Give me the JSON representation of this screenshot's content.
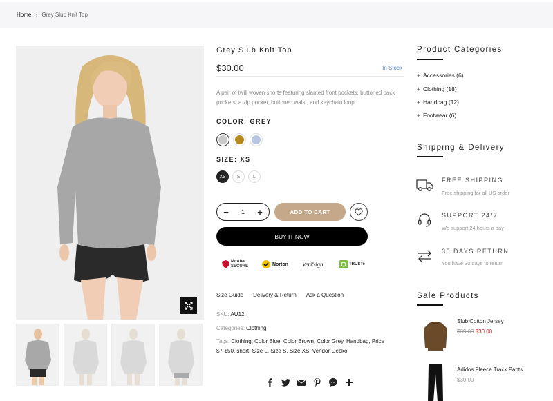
{
  "breadcrumb": {
    "home": "Home",
    "current": "Grey Slub Knit Top"
  },
  "product": {
    "title": "Grey Slub Knit Top",
    "price": "$30.00",
    "stock": "In Stock",
    "description": "A pair of twill woven shorts featuring slanted front pockets, buttoned back pockets, a zip pocket, buttoned waist, and keychain loop.",
    "color_label": "COLOR: GREY",
    "colors": [
      "#c9c9c9",
      "#b58a1e",
      "#b6c6de"
    ],
    "size_label": "SIZE: XS",
    "sizes": [
      "XS",
      "S",
      "L"
    ],
    "quantity": "1",
    "add_to_cart": "ADD TO CART",
    "buy_now": "BUY IT NOW",
    "trust_badges": [
      "McAfee SECURE",
      "Norton",
      "VeriSign",
      "TRUSTe"
    ],
    "links": [
      "Size Guide",
      "Delivery & Return",
      "Ask a Question"
    ],
    "sku_label": "SKU:",
    "sku": "AU12",
    "categories_label": "Categories:",
    "categories": "Clothing",
    "tags_label": "Tags:",
    "tags": "Clothing, Color Blue, Color Brown, Color Grey, Handbag, Price $7-$50, short, Size L, Size S, Size XS, Vendor Gecko"
  },
  "sidebar": {
    "categories_title": "Product Categories",
    "categories": [
      {
        "label": "Accessories (6)"
      },
      {
        "label": "Clothing (18)"
      },
      {
        "label": "Handbag (12)"
      },
      {
        "label": "Footwear (6)"
      }
    ],
    "shipping_title": "Shipping & Delivery",
    "shipping": [
      {
        "icon": "truck-icon",
        "title": "FREE SHIPPING",
        "subtitle": "Free shipping for all US order"
      },
      {
        "icon": "headset-icon",
        "title": "SUPPORT 24/7",
        "subtitle": "We support 24 hours a day"
      },
      {
        "icon": "return-arrows-icon",
        "title": "30 DAYS RETURN",
        "subtitle": "You have 30 days to return"
      }
    ],
    "sale_title": "Sale Products",
    "sale": [
      {
        "name": "Slub Cotton Jersey",
        "old_price": "$39.00",
        "new_price": "$30.00"
      },
      {
        "name": "Adidos Fleece Track Pants",
        "price": "$30.00"
      }
    ]
  }
}
